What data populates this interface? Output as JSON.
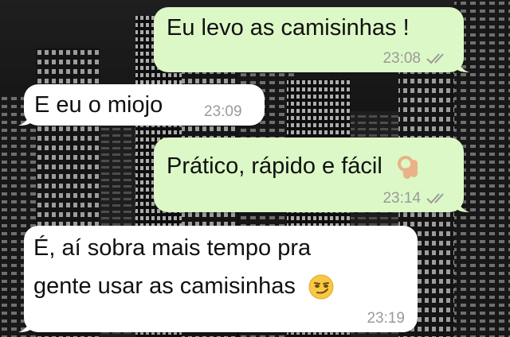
{
  "messages": [
    {
      "direction": "outgoing",
      "text": "Eu levo as camisinhas !",
      "time": "23:08",
      "status": "read-double-check-icon"
    },
    {
      "direction": "incoming",
      "text": "E eu o miojo",
      "time": "23:09"
    },
    {
      "direction": "outgoing",
      "text": "Prático, rápido e fácil",
      "emoji": "ok-hand-emoji-icon",
      "time": "23:14",
      "status": "read-double-check-icon"
    },
    {
      "direction": "incoming",
      "lines": [
        "É, aí sobra mais tempo pra",
        "gente usar as camisinhas"
      ],
      "emoji": "smirking-face-emoji-icon",
      "time": "23:19"
    }
  ],
  "colors": {
    "outgoing_bubble": "#dcf8c6",
    "incoming_bubble": "#ffffff",
    "timestamp": "#9a9a9a",
    "wallpaper": "#0b0b0b"
  }
}
